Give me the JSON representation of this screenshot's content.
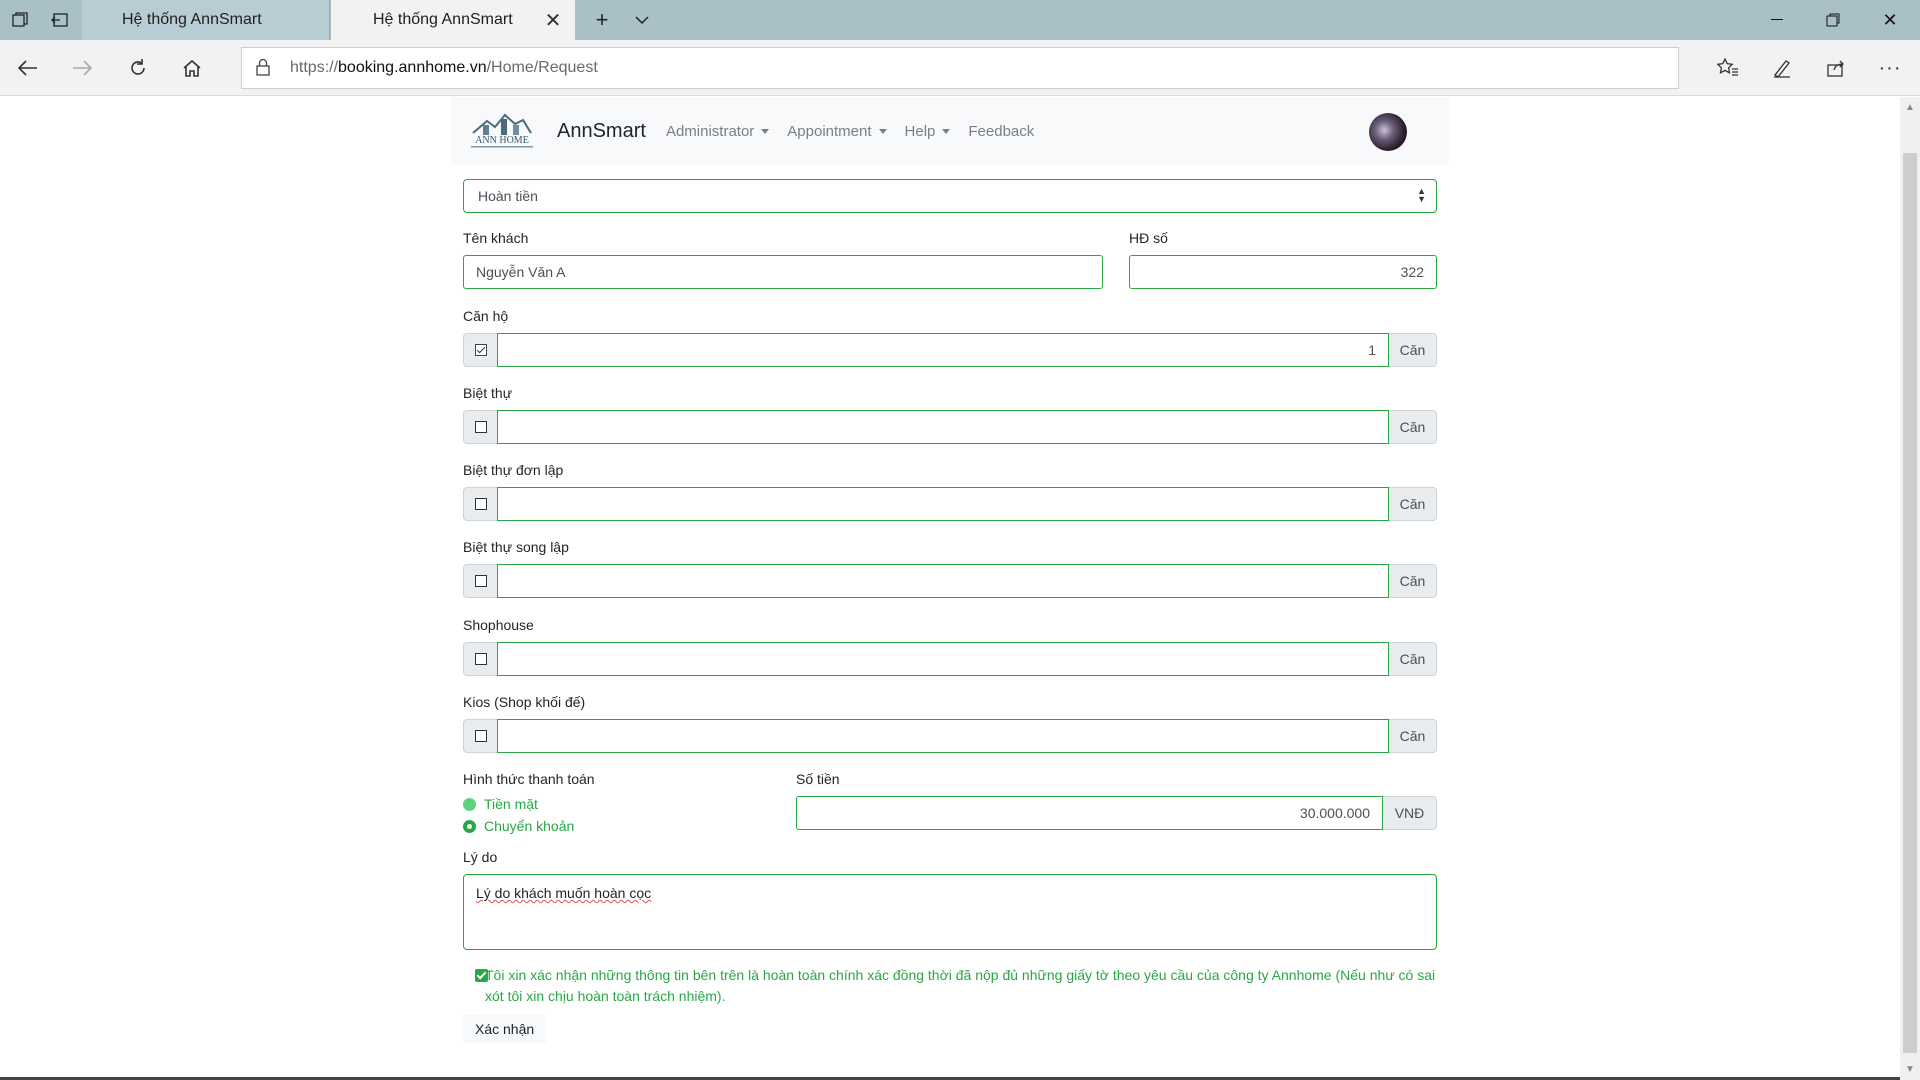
{
  "browser": {
    "tabs": [
      {
        "title": "Hệ thống AnnSmart"
      },
      {
        "title": "Hệ thống AnnSmart"
      }
    ],
    "url": {
      "protocol": "https://",
      "host": "booking.annhome.vn",
      "path": "/Home/Request"
    }
  },
  "app": {
    "brand": "AnnSmart",
    "menu": [
      {
        "label": "Administrator",
        "dropdown": true
      },
      {
        "label": "Appointment",
        "dropdown": true
      },
      {
        "label": "Help",
        "dropdown": true
      },
      {
        "label": "Feedback",
        "dropdown": false
      }
    ]
  },
  "form": {
    "request_type": "Hoàn tiền",
    "customer_label": "Tên khách",
    "customer_value": "Nguyễn Văn A",
    "contract_label": "HĐ số",
    "contract_value": "322",
    "unit_suffix": "Căn",
    "property_types": [
      {
        "label": "Căn hộ",
        "checked": true,
        "value": "1"
      },
      {
        "label": "Biệt thự",
        "checked": false,
        "value": ""
      },
      {
        "label": "Biệt thự đơn lập",
        "checked": false,
        "value": ""
      },
      {
        "label": "Biệt thự song lập",
        "checked": false,
        "value": ""
      },
      {
        "label": "Shophouse",
        "checked": false,
        "value": ""
      },
      {
        "label": "Kios (Shop khối đế)",
        "checked": false,
        "value": ""
      }
    ],
    "payment_label": "Hình thức thanh toán",
    "payment_options": [
      {
        "label": "Tiền mặt",
        "checked": false
      },
      {
        "label": "Chuyển khoản",
        "checked": true
      }
    ],
    "amount_label": "Số tiền",
    "amount_value": "30.000.000",
    "currency": "VNĐ",
    "reason_label": "Lý do",
    "reason_value": "Lý do khách muốn hoàn cọc",
    "confirm_text": "Tôi xin xác nhận những thông tin bên trên là hoàn toàn chính xác đồng thời đã nộp đủ những giấy tờ theo yêu cầu của công ty Annhome (Nếu như có sai xót tôi xin chịu hoàn toàn trách nhiệm).",
    "submit_label": "Xác nhận"
  },
  "colors": {
    "accent": "#28a745",
    "tabbar": "#a9c0c7"
  }
}
